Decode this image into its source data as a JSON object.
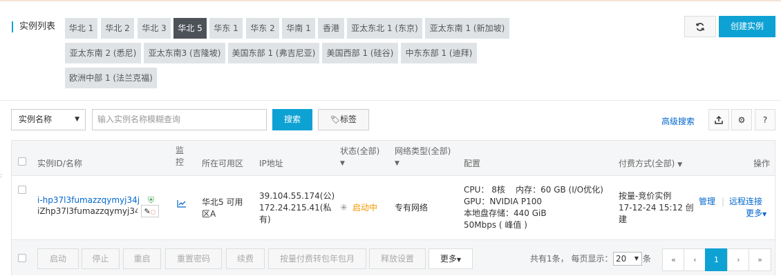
{
  "header": {
    "title": "实例列表",
    "regions": [
      "华北 1",
      "华北 2",
      "华北 3",
      "华北 5",
      "华东 1",
      "华东 2",
      "华南 1",
      "香港",
      "亚太东北 1 (东京)",
      "亚太东南 1 (新加坡)",
      "亚太东南 2 (悉尼)",
      "亚太东南3 (吉隆坡)",
      "美国东部 1 (弗吉尼亚)",
      "美国西部 1 (硅谷)",
      "中东东部 1 (迪拜)",
      "欧洲中部 1 (法兰克福)"
    ],
    "active_region": "华北 5",
    "create_label": "创建实例",
    "refresh_icon": "refresh-icon"
  },
  "search": {
    "filter_select": "实例名称",
    "placeholder": "输入实例名称模糊查询",
    "search_label": "搜索",
    "tag_label": "标签",
    "advanced_label": "高级搜索",
    "help_label": "?"
  },
  "table": {
    "headers": {
      "id_name": "实例ID/名称",
      "monitor": "监控",
      "zone": "所在可用区",
      "ip": "IP地址",
      "status": "状态(全部)",
      "network": "网络类型(全部)",
      "config": "配置",
      "billing": "付费方式(全部)",
      "actions": "操作"
    },
    "rows": [
      {
        "instance_id": "i-hp37l3fumazzqymyj34j",
        "instance_name": "iZhp37l3fumazzqymyj34j...",
        "zone": "华北5 可用区A",
        "ip_public": "39.104.55.174(公)",
        "ip_private": "172.24.215.41(私有)",
        "status": "启动中",
        "network": "专有网络",
        "config": [
          "CPU： 8核    内存：60 GB (I/O优化)",
          "GPU：NVIDIA P100",
          "本地盘存储：440 GiB",
          "50Mbps ( 峰值 )"
        ],
        "billing_type": "按量-竞价实例",
        "billing_time": "17-12-24 15:12 创建",
        "action_manage": "管理",
        "action_connect": "远程连接",
        "action_more": "更多"
      }
    ]
  },
  "footer": {
    "buttons": [
      "启动",
      "停止",
      "重启",
      "重置密码",
      "续费",
      "按量付费转包年包月",
      "释放设置"
    ],
    "more_label": "更多",
    "total_text": "共有1条， 每页显示：",
    "page_size": "20",
    "unit_text": "条",
    "pager": [
      "«",
      "‹",
      "1",
      "›",
      "»"
    ],
    "current_page": "1"
  },
  "colors": {
    "accent": "#0ea2d4",
    "active_region": "#4d5259",
    "status": "#f39800",
    "link": "#0066cc"
  }
}
